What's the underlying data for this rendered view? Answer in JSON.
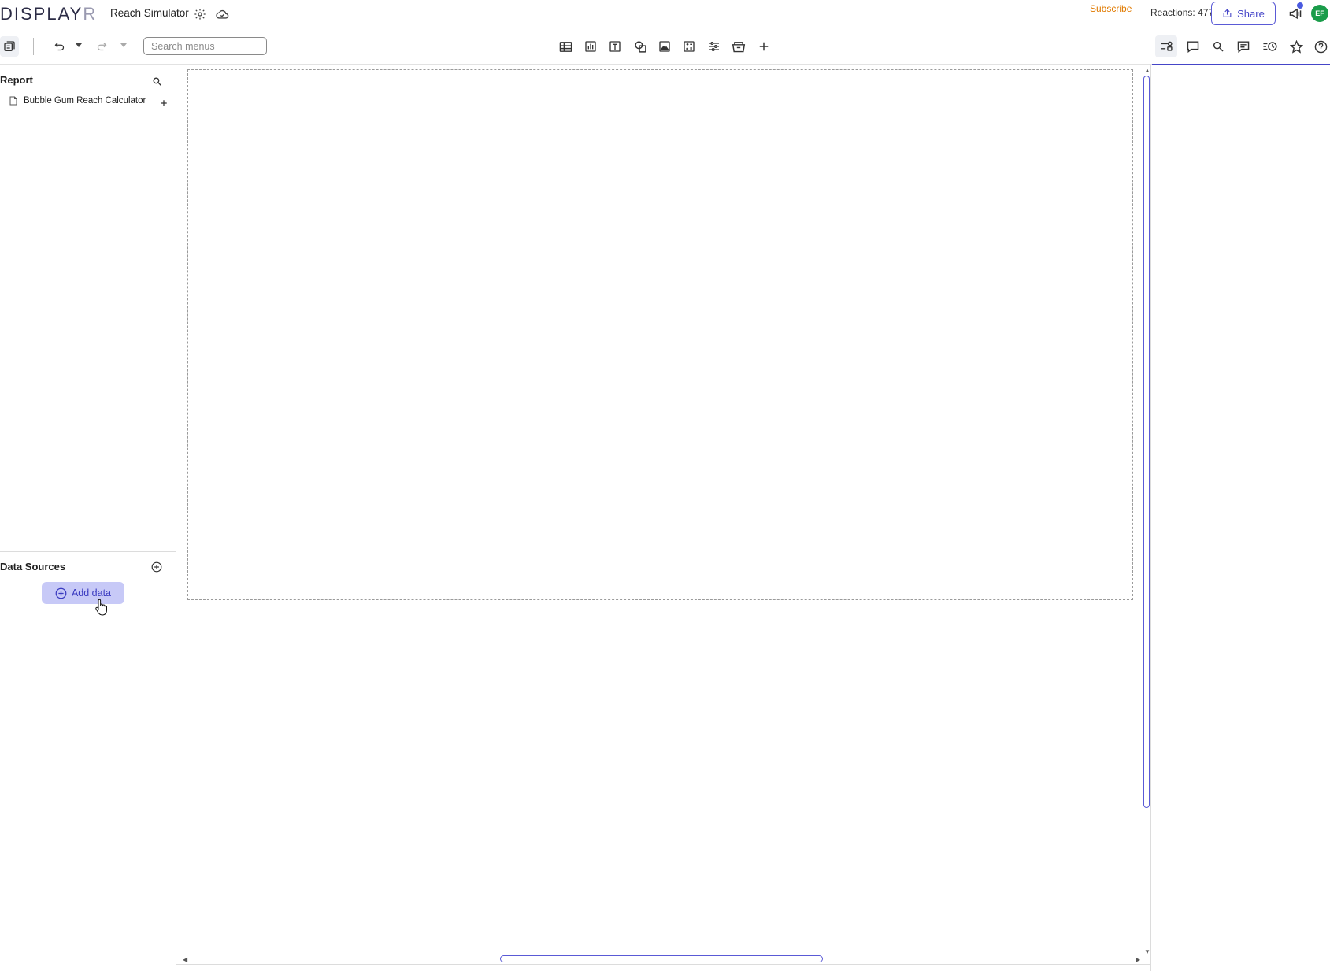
{
  "app": {
    "logo_main": "DISPLAY",
    "logo_tail": "R",
    "document_title": "Reach Simulator"
  },
  "header": {
    "subscribe_label": "Subscribe",
    "reactions_label": "Reactions: 477",
    "share_label": "Share",
    "avatar_initials": "EF"
  },
  "toolbar": {
    "search_placeholder": "Search menus"
  },
  "sidebar": {
    "report_heading": "Report",
    "pages": [
      {
        "label": "Bubble Gum Reach Calculator"
      }
    ],
    "data_sources_heading": "Data Sources",
    "add_data_label": "Add data"
  },
  "colors": {
    "accent": "#4545c8",
    "subscribe": "#e07a00",
    "avatar": "#1a9c4a",
    "add_data_bg": "#c7c9f7"
  }
}
